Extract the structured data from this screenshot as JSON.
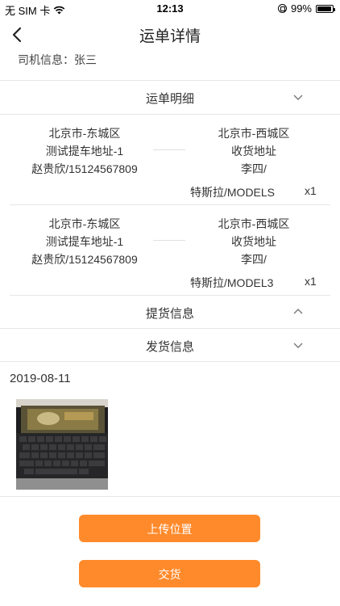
{
  "status_bar": {
    "carrier": "无 SIM 卡",
    "time": "12:13",
    "battery": "99%",
    "battery_level": 0.99
  },
  "nav": {
    "title": "运单详情"
  },
  "driver": {
    "text": "司机信息：张三"
  },
  "sections": {
    "details": "运单明细",
    "pickup": "提货信息",
    "delivery": "发货信息"
  },
  "orders": [
    {
      "from": [
        "北京市-东城区",
        "测试提车地址-1",
        "赵贵欣/15124567809"
      ],
      "to": [
        "北京市-西城区",
        "收货地址",
        "李四/"
      ],
      "vehicle": "特斯拉/MODELS",
      "qty": "x1"
    },
    {
      "from": [
        "北京市-东城区",
        "测试提车地址-1",
        "赵贵欣/15124567809"
      ],
      "to": [
        "北京市-西城区",
        "收货地址",
        "李四/"
      ],
      "vehicle": "特斯拉/MODEL3",
      "qty": "x1"
    }
  ],
  "delivery": {
    "date": "2019-08-11"
  },
  "buttons": {
    "upload_location": "上传位置",
    "deliver": "交货"
  },
  "colors": {
    "accent": "#ff8a2b",
    "divider": "#e6e6e6"
  }
}
